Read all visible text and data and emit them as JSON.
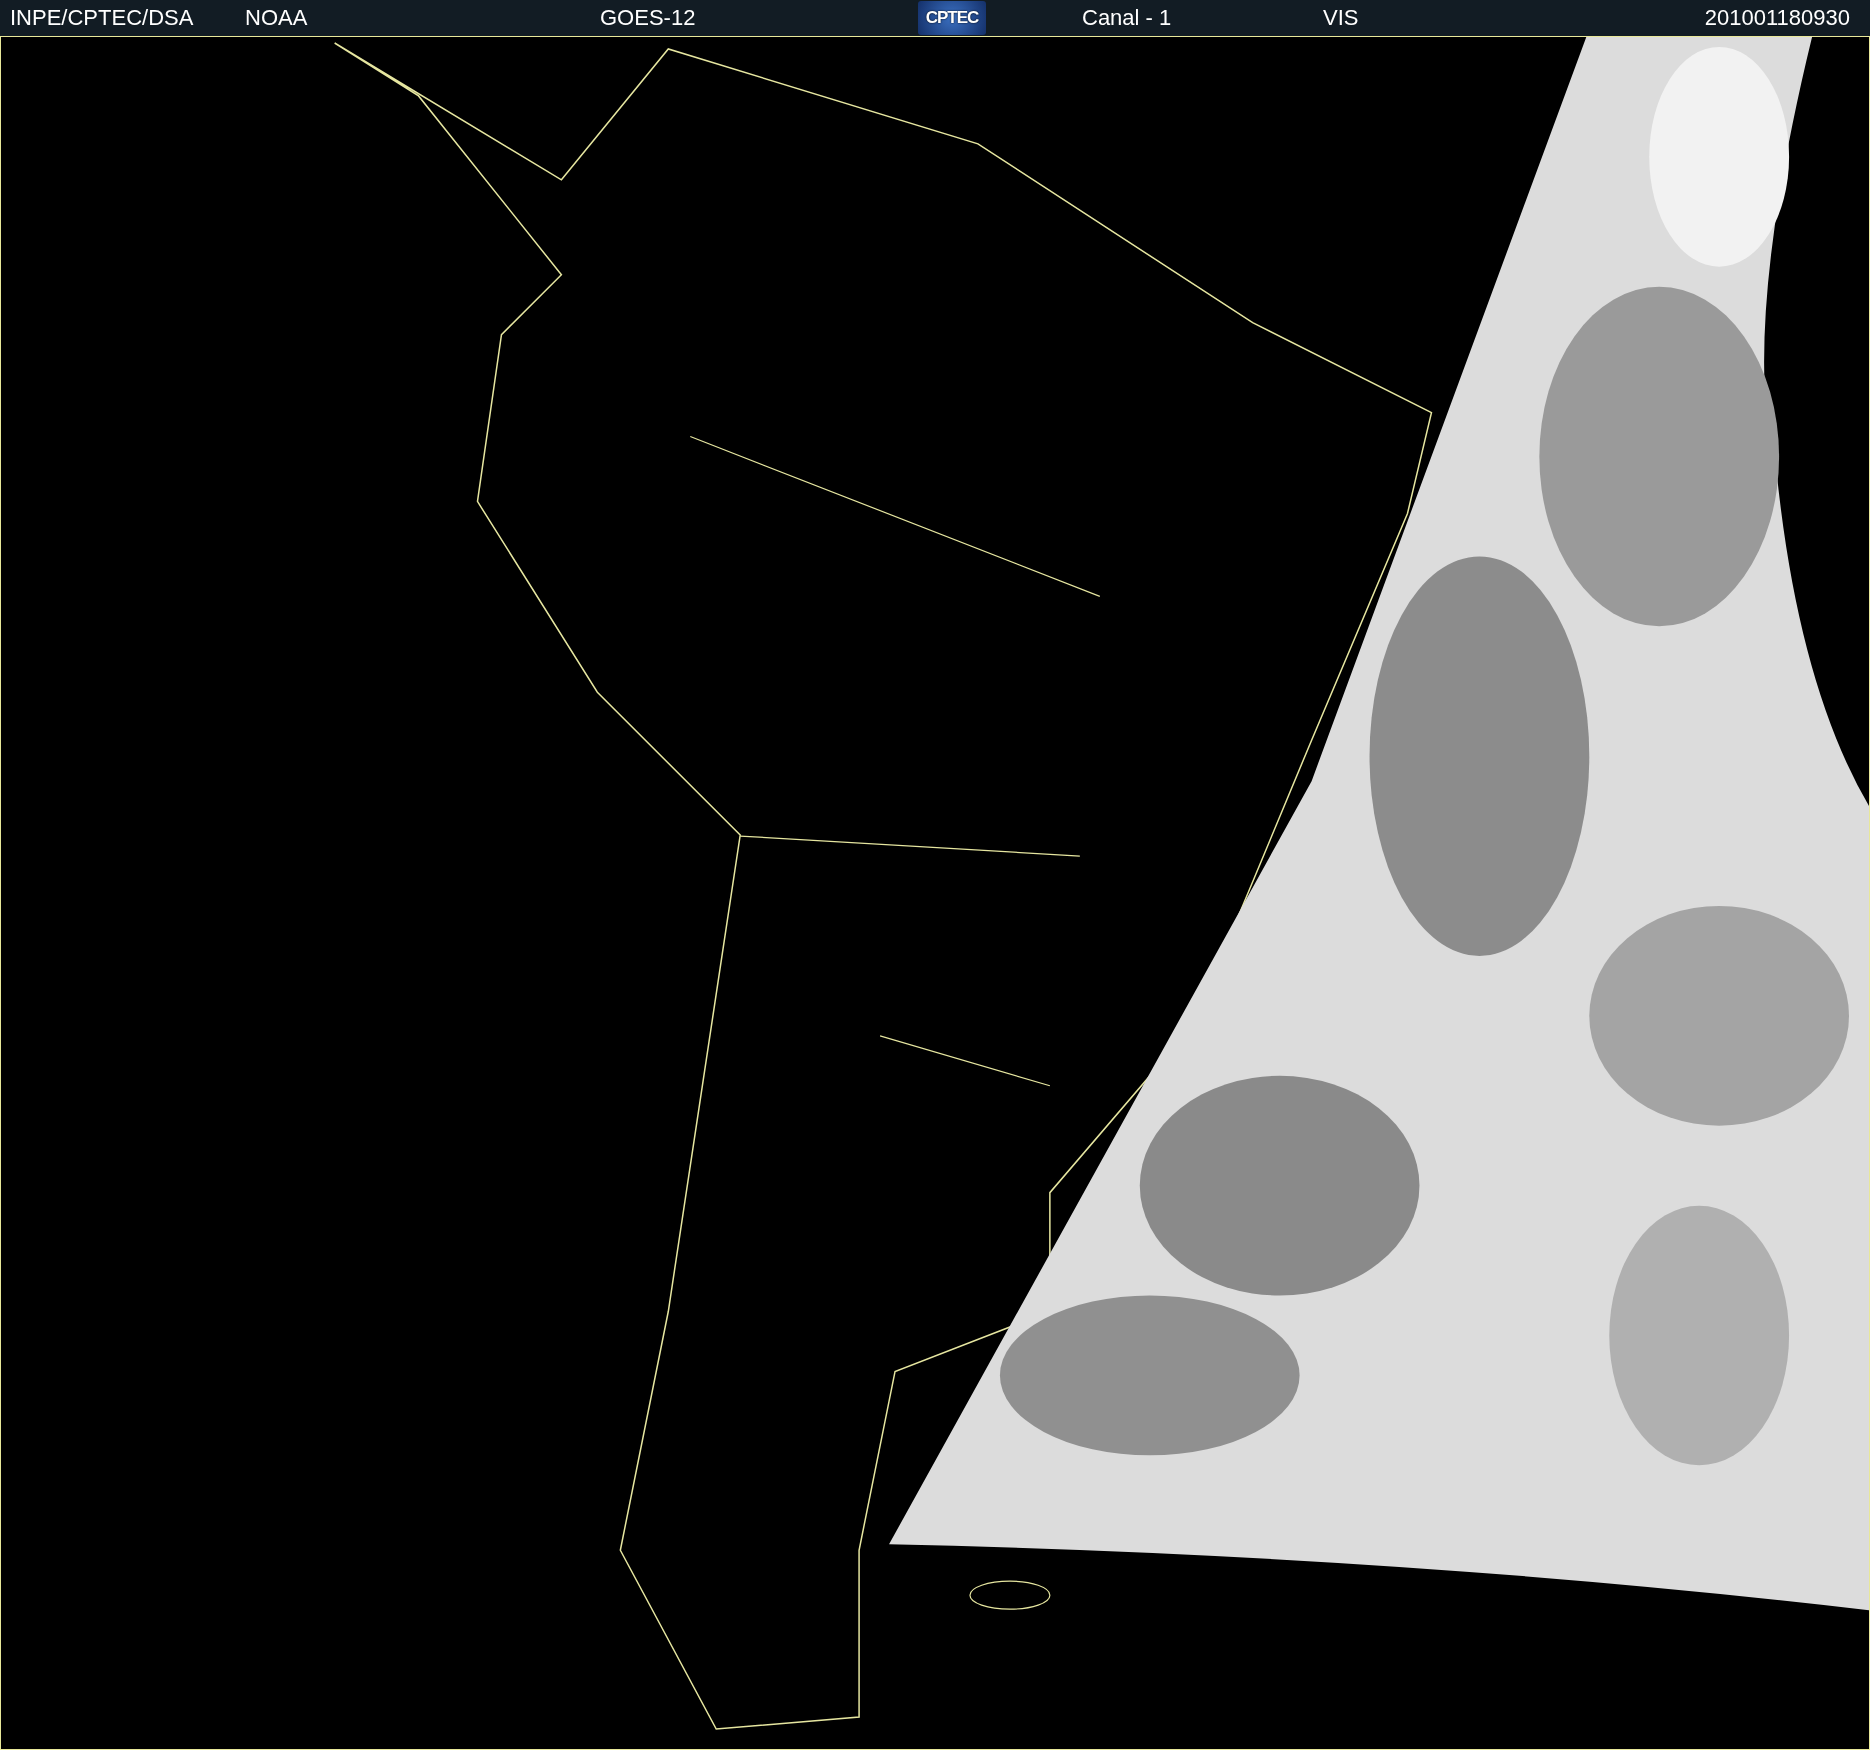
{
  "header": {
    "items": [
      {
        "kind": "text",
        "text": "INPE/CPTEC/DSA"
      },
      {
        "kind": "text",
        "text": "NOAA"
      },
      {
        "kind": "text",
        "text": "GOES-12"
      },
      {
        "kind": "logo",
        "text": "CPTEC"
      },
      {
        "kind": "text",
        "text": "Canal - 1"
      },
      {
        "kind": "text",
        "text": "VIS"
      },
      {
        "kind": "text",
        "text": "201001180930"
      }
    ]
  }
}
